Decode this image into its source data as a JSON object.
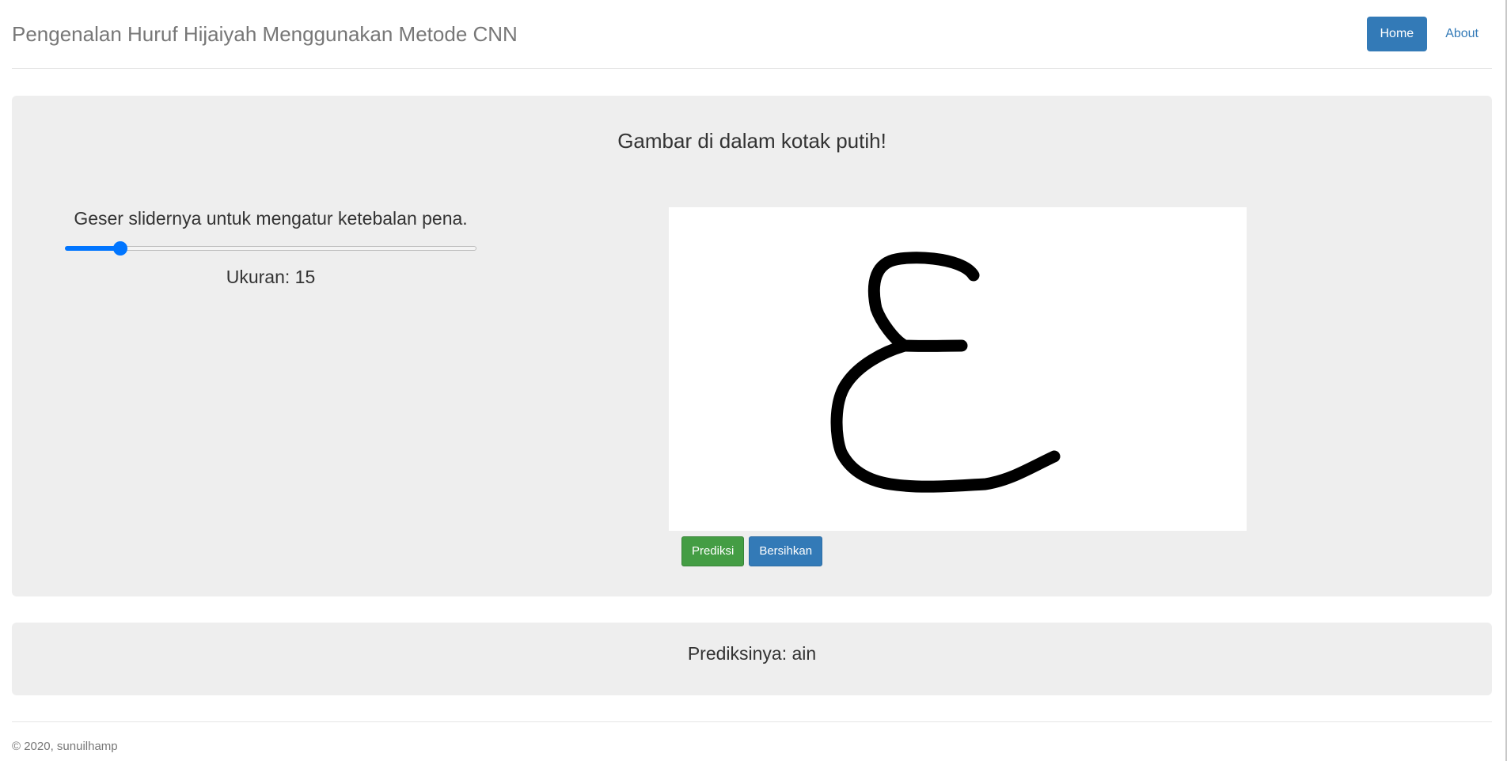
{
  "header": {
    "title": "Pengenalan Huruf Hijaiyah Menggunakan Metode CNN",
    "nav": [
      {
        "label": "Home",
        "active": true
      },
      {
        "label": "About",
        "active": false
      }
    ]
  },
  "main": {
    "instruction": "Gambar di dalam kotak putih!",
    "slider": {
      "label": "Geser slidernya untuk mengatur ketebalan pena.",
      "value_text": "Ukuran: 15",
      "value": 15,
      "level": 0.135
    },
    "canvas": {
      "drawn_glyph": "ain",
      "stroke_color": "#000000"
    },
    "buttons": {
      "predict": "Prediksi",
      "clear": "Bersihkan"
    }
  },
  "result": {
    "text": "Prediksinya: ain"
  },
  "footer": {
    "text": "© 2020, sunuilhamp"
  },
  "colors": {
    "primary": "#337ab7",
    "success": "#449d44",
    "panel_bg": "#eeeeee",
    "slider_accent": "#0075ff"
  }
}
